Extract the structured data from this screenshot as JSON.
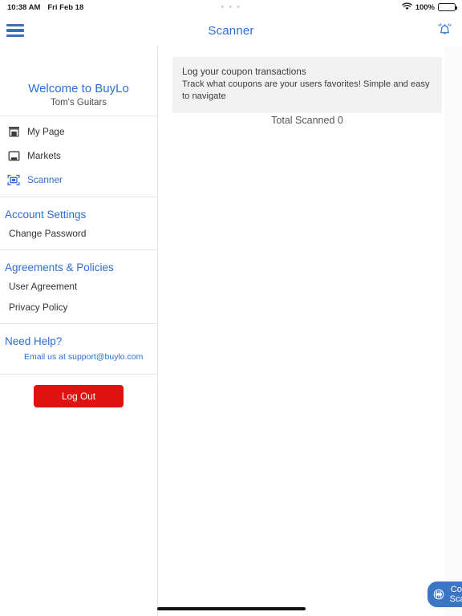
{
  "status_bar": {
    "time": "10:38 AM",
    "date": "Fri Feb 18",
    "center_dots": "• • •",
    "battery_percent": "100%",
    "wifi_icon": "wifi-icon",
    "battery_icon": "battery-full-icon"
  },
  "navbar": {
    "menu_icon": "hamburger-menu-icon",
    "title": "Scanner",
    "bell_icon": "notification-bell-icon"
  },
  "sidebar": {
    "welcome_title": "Welcome to BuyLo",
    "store_name": "Tom's Guitars",
    "nav_items": [
      {
        "label": "My Page",
        "icon": "store-icon",
        "active": false
      },
      {
        "label": "Markets",
        "icon": "market-stall-icon",
        "active": false
      },
      {
        "label": "Scanner",
        "icon": "barcode-scan-icon",
        "active": true
      }
    ],
    "account_settings": {
      "heading": "Account Settings",
      "links": [
        "Change Password"
      ]
    },
    "agreements": {
      "heading": "Agreements & Policies",
      "links": [
        "User Agreement",
        "Privacy Policy"
      ]
    },
    "help": {
      "heading": "Need Help?",
      "email_text": "Email us at support@buylo.com"
    },
    "logout_label": "Log Out",
    "logout_color": "#e01111",
    "accent_color": "#2c6ed5"
  },
  "main": {
    "info_card": {
      "title": "Log your coupon transactions",
      "description": "Track what coupons are your users favorites! Simple and easy to navigate"
    },
    "total_scanned_label": "Total Scanned 0",
    "fab": {
      "label": "Coupon Scanner",
      "icon": "coupon-scan-icon",
      "color": "#3a76c4"
    }
  }
}
